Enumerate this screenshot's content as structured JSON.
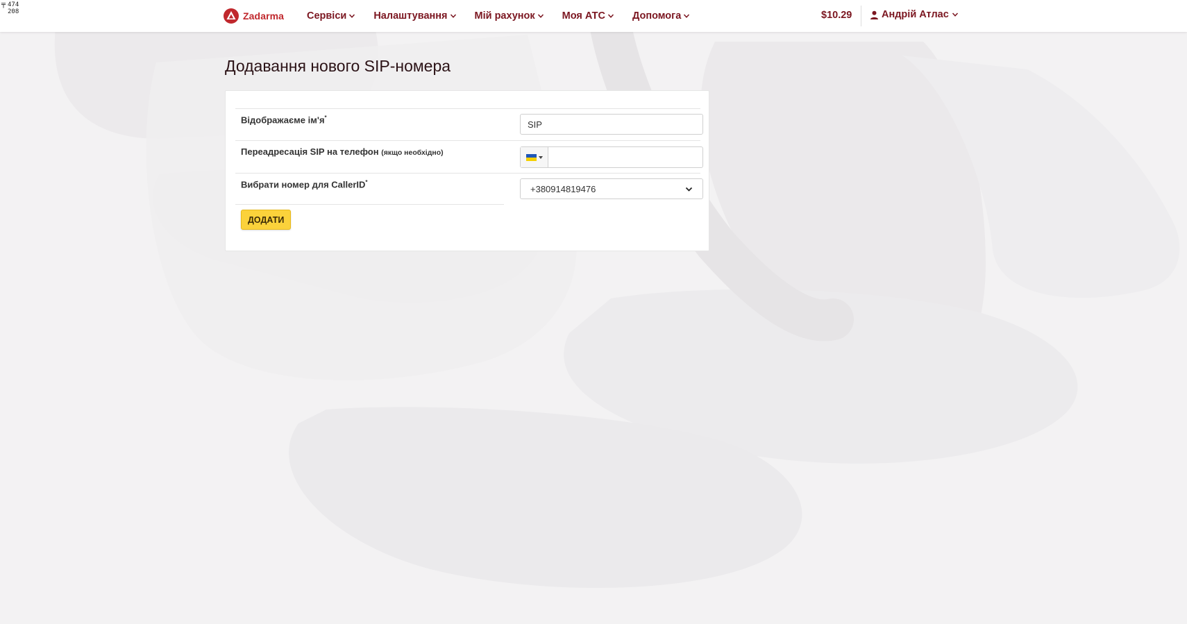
{
  "cursor_readout": {
    "x": "474",
    "y": "208"
  },
  "header": {
    "brand": "Zadarma",
    "nav": [
      {
        "label": "Сервіси"
      },
      {
        "label": "Налаштування"
      },
      {
        "label": "Мій рахунок"
      },
      {
        "label": "Моя АТС"
      },
      {
        "label": "Допомога"
      }
    ],
    "balance": "$10.29",
    "user_name": "Андрій Атлас"
  },
  "page": {
    "title": "Додавання нового SIP-номера"
  },
  "form": {
    "display_name": {
      "label": "Відображаєме ім'я",
      "required_mark": "*",
      "value": "SIP"
    },
    "forwarding": {
      "label": "Переадресація SIP на телефон",
      "hint": "(якщо необхідно)",
      "country_flag": "ukraine-flag",
      "value": ""
    },
    "caller_id": {
      "label": "Вибрати номер для CallerID",
      "required_mark": "*",
      "selected": "+380914819476"
    },
    "submit_label": "ДОДАТИ"
  },
  "colors": {
    "brand_red": "#c0282d",
    "nav_text": "#7b1620",
    "button_yellow": "#fbd23b"
  }
}
